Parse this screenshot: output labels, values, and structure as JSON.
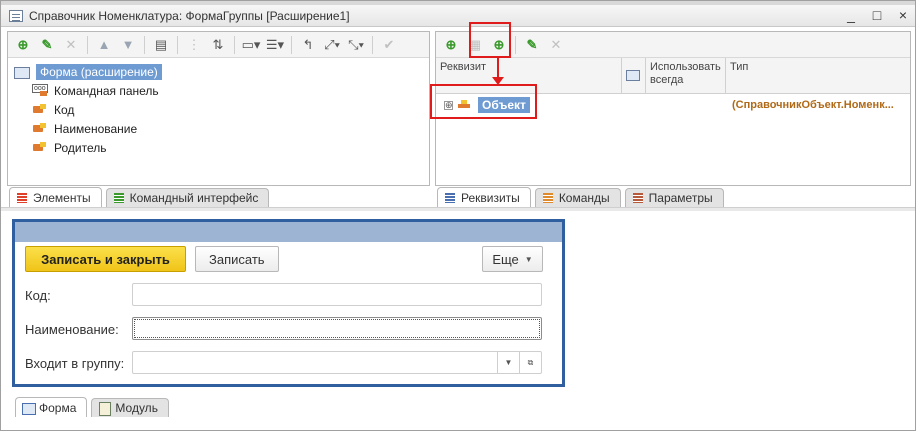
{
  "window": {
    "title": "Справочник Номенклатура: ФормаГруппы [Расширение1]",
    "controls": [
      "_",
      "□",
      "×"
    ]
  },
  "left_panel": {
    "toolbar_icons": [
      "add-icon",
      "edit-icon",
      "delete-icon",
      "move-up-icon",
      "move-down-icon",
      "structure-icon",
      "filter-icon",
      "sort-icon",
      "form-layout-icon",
      "group-icon",
      "transfer-icon",
      "fields-icon",
      "expand-icon",
      "check-icon"
    ],
    "tree": {
      "root": "Форма (расширение)",
      "children": [
        {
          "label": "Командная панель",
          "icon": "command-bar-icon"
        },
        {
          "label": "Код",
          "icon": "field-icon"
        },
        {
          "label": "Наименование",
          "icon": "field-icon"
        },
        {
          "label": "Родитель",
          "icon": "field-icon"
        }
      ]
    },
    "tabs": [
      {
        "label": "Элементы",
        "icon": "elements-icon",
        "active": true
      },
      {
        "label": "Командный интерфейс",
        "icon": "command-interface-icon",
        "active": false
      }
    ]
  },
  "right_panel": {
    "toolbar_icons": [
      "add-attribute-icon",
      "add-column-icon",
      "add-from-object-icon",
      "edit-icon",
      "delete-icon"
    ],
    "columns": {
      "rekvizit": "Реквизит",
      "use_always": "Использовать всегда",
      "type": "Тип"
    },
    "row": {
      "expander": "⊕",
      "name": "Объект",
      "type": "(СправочникОбъект.Номенк..."
    },
    "tabs": [
      {
        "label": "Реквизиты",
        "icon": "attributes-icon",
        "active": true
      },
      {
        "label": "Команды",
        "icon": "commands-icon",
        "active": false
      },
      {
        "label": "Параметры",
        "icon": "parameters-icon",
        "active": false
      }
    ]
  },
  "preview_form": {
    "buttons": {
      "save_close": "Записать и закрыть",
      "save": "Записать",
      "more": "Еще"
    },
    "fields": [
      {
        "label": "Код:",
        "value": ""
      },
      {
        "label": "Наименование:",
        "value": ""
      },
      {
        "label": "Входит в группу:",
        "value": ""
      }
    ],
    "colors": {
      "primary_button": "#f0c419",
      "frame": "#2f5f9e",
      "highlight": "#e01b1b"
    }
  },
  "bottom_tabs": [
    {
      "label": "Форма",
      "icon": "form-icon",
      "active": true
    },
    {
      "label": "Модуль",
      "icon": "module-icon",
      "active": false
    }
  ]
}
